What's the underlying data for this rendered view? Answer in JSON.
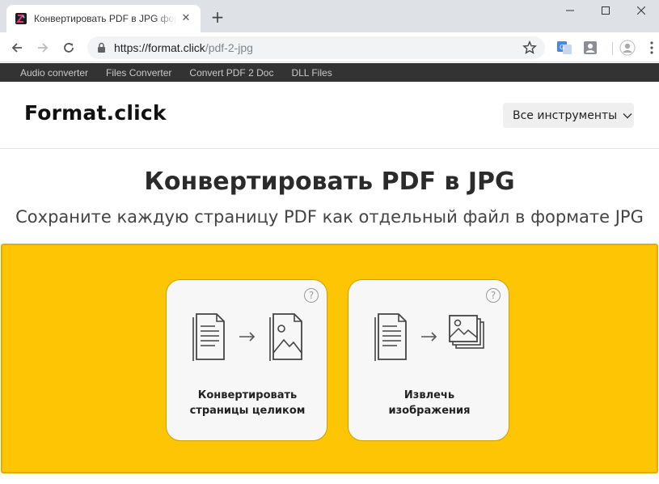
{
  "browser": {
    "tab_title": "Конвертировать PDF в JPG формат",
    "url_host": "https://format.click",
    "url_path": "/pdf-2-jpg"
  },
  "topnav": {
    "items": [
      "Audio converter",
      "Files Converter",
      "Convert PDF 2 Doc",
      "DLL Files"
    ]
  },
  "header": {
    "logo": "Format.click",
    "tools_button": "Все инструменты"
  },
  "hero": {
    "title": "Конвертировать PDF в JPG",
    "subtitle": "Сохраните каждую страницу PDF как отдельный файл в формате JPG"
  },
  "cards": [
    {
      "line1": "Конвертировать",
      "line2": "страницы целиком",
      "help": "?"
    },
    {
      "line1": "Извлечь",
      "line2": "изображения",
      "help": "?"
    }
  ],
  "colors": {
    "panel": "#fdc504",
    "topnav": "#333333"
  }
}
